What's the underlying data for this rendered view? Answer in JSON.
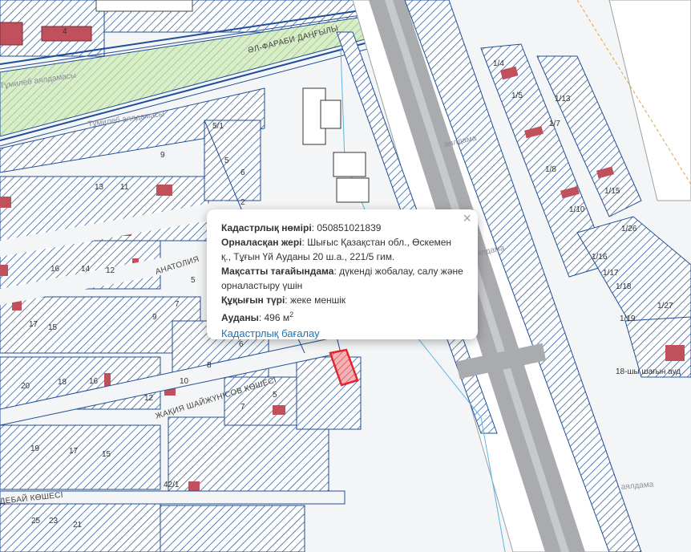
{
  "map": {
    "street_labels": {
      "al_farabi": "ӘЛ-ФАРАБИ ДАҢҒЫЛЫ",
      "tupik1": "Тұмилеб аялдамасы",
      "tupik2": "Тұмилеб аялдамасы",
      "anatoliy": "АНАТОЛИЯ",
      "zhakiya": "ЖАҚИЯ ШАЙЖҮНІСОВ КӨШЕСІ",
      "kobdebay": "ДЕБАЙ КӨШЕСІ",
      "ayaldama1": "аялдама",
      "ayaldama2": "аялдама",
      "ayaldama3": "аялдама",
      "shagyn": "18-шы шағын ауд"
    },
    "parcel_numbers": [
      "4",
      "5/1",
      "5",
      "9",
      "13",
      "11",
      "2",
      "6",
      "16",
      "14",
      "12",
      "5",
      "7",
      "9",
      "8",
      "6",
      "17",
      "15",
      "20",
      "18",
      "16",
      "10",
      "12",
      "7",
      "5",
      "19",
      "17",
      "15",
      "42/1",
      "25",
      "23",
      "21",
      "1/4",
      "1/5",
      "1/13",
      "1/7",
      "1/8",
      "1/10",
      "1/15",
      "1/26",
      "1/16",
      "1/17",
      "1/18",
      "1/19",
      "1/27"
    ],
    "colors": {
      "hatch": "#1f4e96",
      "selected": "#e3242b",
      "road": "#a9abae",
      "green": "#d7efc4",
      "building": "#c0505c"
    }
  },
  "popup": {
    "close_symbol": "×",
    "cadastral_label": "Кадастрлық нөмірі",
    "cadastral_value": "050851021839",
    "location_label": "Орналасқан жері",
    "location_value": "Шығыс Қазақстан обл., Өскемен қ., Тұғын Үй Ауданы 20 ш.а., 221/5 гим.",
    "purpose_label": "Мақсатты тағайындама",
    "purpose_value": "дүкенді жобалау, салу және орналастыру үшін",
    "right_label": "Құқығын түрі",
    "right_value": "жеке меншік",
    "area_label": "Ауданы",
    "area_value": "496 м",
    "area_unit_sup": "2",
    "link": "Кадастрлық бағалау"
  }
}
